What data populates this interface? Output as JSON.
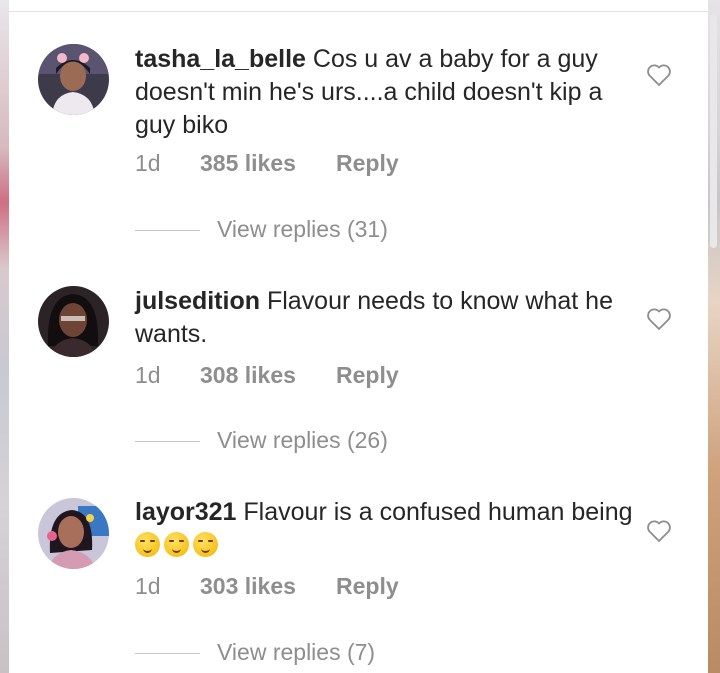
{
  "comments": [
    {
      "username": "tasha_la_belle",
      "text": " Cos u av a baby for a guy doesn't min he's urs....a child doesn't kip a guy biko",
      "time": "1d",
      "likes": "385 likes",
      "reply": "Reply",
      "view_replies": "View replies (31)",
      "avatar_icon": "avatar-photo-icon"
    },
    {
      "username": "julsedition",
      "text": " Flavour needs to know what he wants.",
      "time": "1d",
      "likes": "308 likes",
      "reply": "Reply",
      "view_replies": "View replies (26)",
      "avatar_icon": "avatar-photo-icon"
    },
    {
      "username": "layor321",
      "text": " Flavour is a confused human being ",
      "emojis": [
        "smirking-face-emoji",
        "smirking-face-emoji",
        "smirking-face-emoji"
      ],
      "time": "1d",
      "likes": "303 likes",
      "reply": "Reply",
      "view_replies": "View replies (7)",
      "avatar_icon": "avatar-photo-icon"
    }
  ],
  "colors": {
    "text_primary": "#262626",
    "text_secondary": "#8e8e8e",
    "divider": "#c7c7c7",
    "background": "#ffffff"
  },
  "icons": {
    "like": "heart-outline-icon"
  }
}
